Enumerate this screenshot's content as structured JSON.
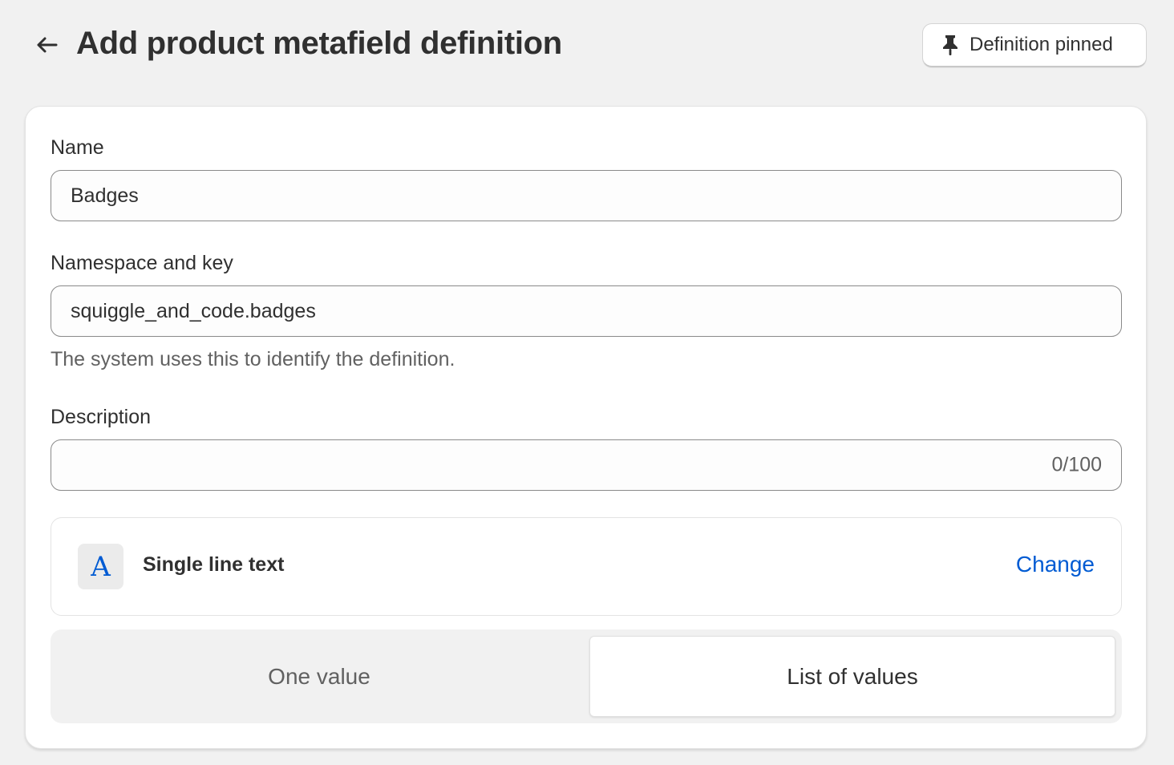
{
  "header": {
    "title": "Add product metafield definition",
    "back_icon": "arrow-left-icon",
    "pin_button": {
      "label": "Definition pinned",
      "icon": "pin-icon"
    }
  },
  "form": {
    "name": {
      "label": "Name",
      "value": "Badges"
    },
    "namespace_key": {
      "label": "Namespace and key",
      "value": "squiggle_and_code.badges",
      "help_text": "The system uses this to identify the definition."
    },
    "description": {
      "label": "Description",
      "value": "",
      "counter": "0/100"
    },
    "type": {
      "icon_glyph": "A",
      "icon": "text-type-icon",
      "name": "Single line text",
      "change_label": "Change"
    },
    "value_mode": {
      "options": [
        "One value",
        "List of values"
      ],
      "selected": "List of values"
    }
  },
  "colors": {
    "background": "#f1f1f1",
    "accent": "#005bd3",
    "text": "#303030",
    "subdued": "#616161"
  }
}
